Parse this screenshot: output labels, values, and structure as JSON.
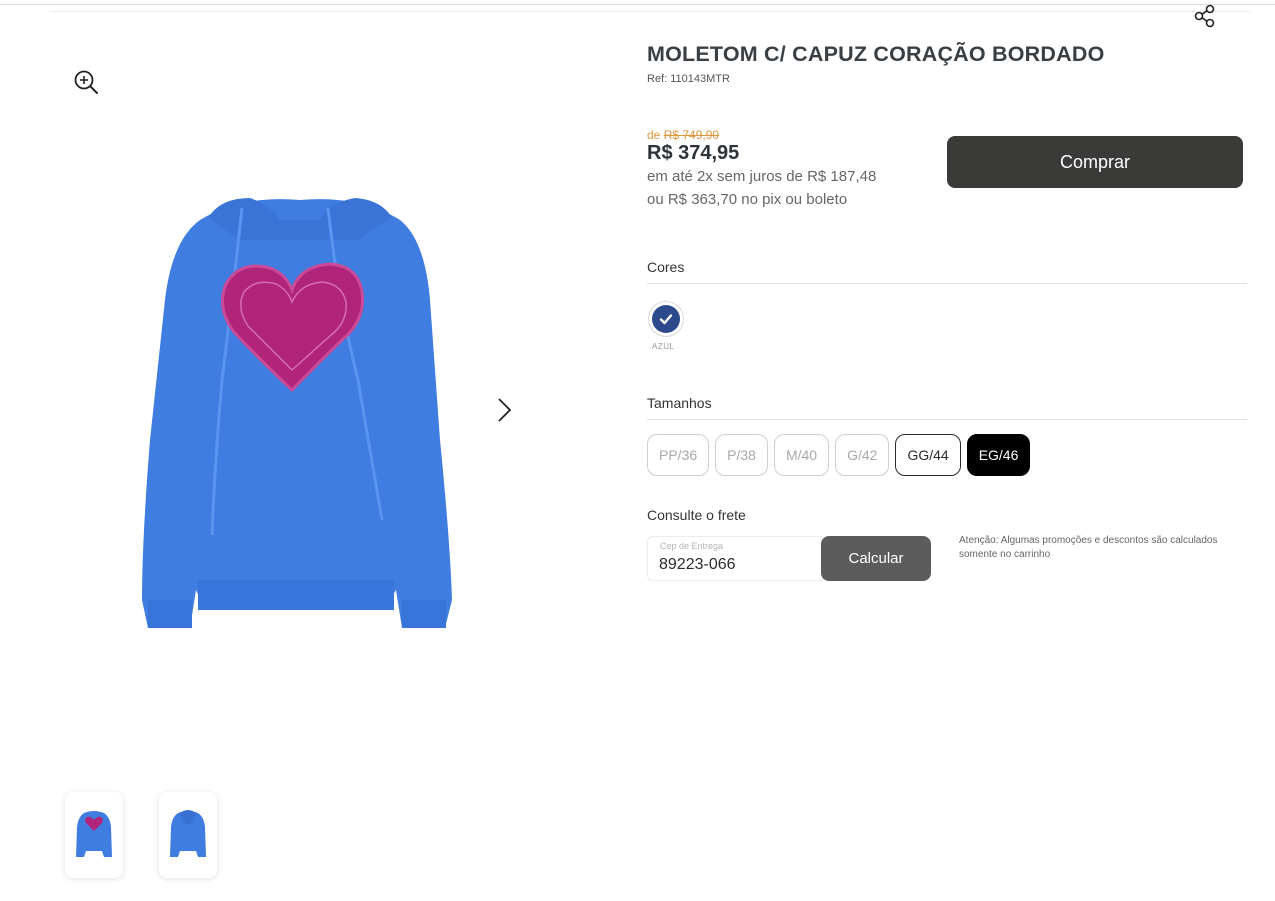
{
  "product": {
    "title": "MOLETOM C/ CAPUZ CORAÇÃO BORDADO",
    "ref": "Ref: 110143MTR"
  },
  "pricing": {
    "old_prefix": "de",
    "old_price": "R$ 749,90",
    "price": "R$ 374,95",
    "installments": "em até 2x sem juros de R$ 187,48",
    "pix": "ou R$ 363,70 no pix ou boleto",
    "buy_label": "Comprar"
  },
  "colors": {
    "label": "Cores",
    "options": [
      {
        "name": "AZUL",
        "hex": "#2c4a8c",
        "selected": true
      }
    ]
  },
  "sizes": {
    "label": "Tamanhos",
    "options": [
      {
        "label": "PP/36",
        "state": "unavailable"
      },
      {
        "label": "P/38",
        "state": "unavailable"
      },
      {
        "label": "M/40",
        "state": "unavailable"
      },
      {
        "label": "G/42",
        "state": "unavailable"
      },
      {
        "label": "GG/44",
        "state": "available"
      },
      {
        "label": "EG/46",
        "state": "selected"
      }
    ]
  },
  "shipping": {
    "label": "Consulte o frete",
    "cep_label": "Cep de Entrega",
    "cep_value": "89223-066",
    "calc_label": "Calcular",
    "notice": "Atenção: Algumas promoções e descontos são calculados somente no carrinho"
  },
  "colors_theme": {
    "product_blue": "#3f7de0",
    "heart_pink": "#b0247a",
    "old_price": "#e0963b",
    "buy_button": "#3a3b39"
  },
  "icons": {
    "zoom": "zoom-in-icon",
    "share": "share-icon",
    "next": "chevron-right-icon",
    "check": "check-icon"
  }
}
